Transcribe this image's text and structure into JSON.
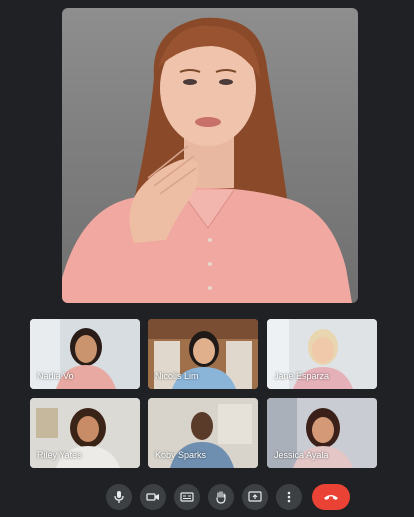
{
  "main_speaker": {
    "name": ""
  },
  "participants": [
    {
      "name": "Nadia Vo"
    },
    {
      "name": "Nicolis Lim"
    },
    {
      "name": "Jane Esparza"
    },
    {
      "name": "Riley Yates"
    },
    {
      "name": "Koby Sparks"
    },
    {
      "name": "Jessica Ayala"
    }
  ],
  "controls": [
    {
      "icon": "microphone-icon"
    },
    {
      "icon": "camera-icon"
    },
    {
      "icon": "captions-icon"
    },
    {
      "icon": "raise-hand-icon"
    },
    {
      "icon": "present-screen-icon"
    },
    {
      "icon": "more-options-icon"
    },
    {
      "icon": "end-call-icon"
    }
  ],
  "colors": {
    "background": "#202124",
    "button": "#3c4043",
    "end_call": "#ea4335"
  }
}
